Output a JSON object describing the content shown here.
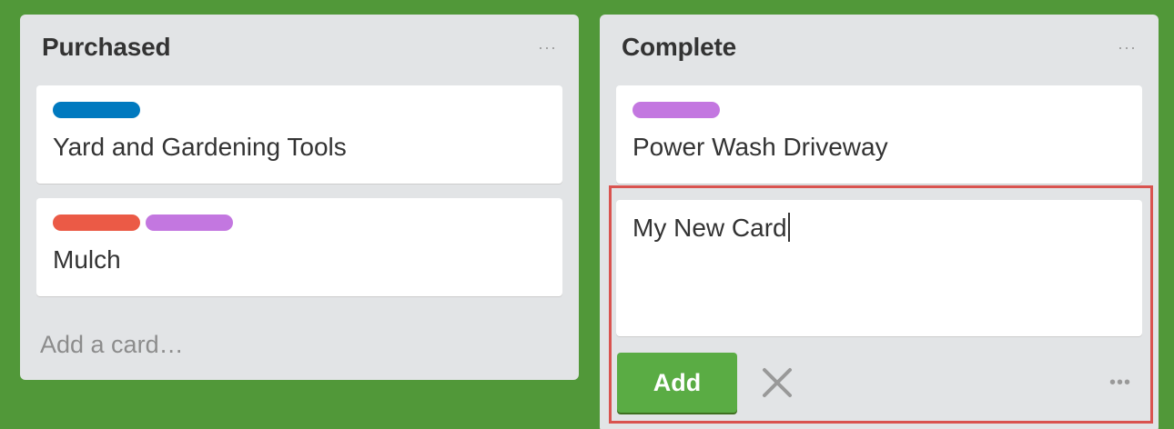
{
  "lists": [
    {
      "title": "Purchased",
      "menu_glyph": "···",
      "cards": [
        {
          "title": "Yard and Gardening Tools",
          "labels": [
            "#0079bf"
          ]
        },
        {
          "title": "Mulch",
          "labels": [
            "#eb5a46",
            "#c377e0"
          ]
        }
      ],
      "add_card_text": "Add a card…"
    },
    {
      "title": "Complete",
      "menu_glyph": "···",
      "cards": [
        {
          "title": "Power Wash Driveway",
          "labels": [
            "#c377e0"
          ]
        }
      ],
      "composer": {
        "value": "My New Card",
        "add_label": "Add",
        "menu_glyph": "•••",
        "close_icon": "close-icon"
      }
    }
  ],
  "colors": {
    "board_background": "#519839",
    "add_button": "#5aac44",
    "highlight_border": "#d9534f"
  }
}
